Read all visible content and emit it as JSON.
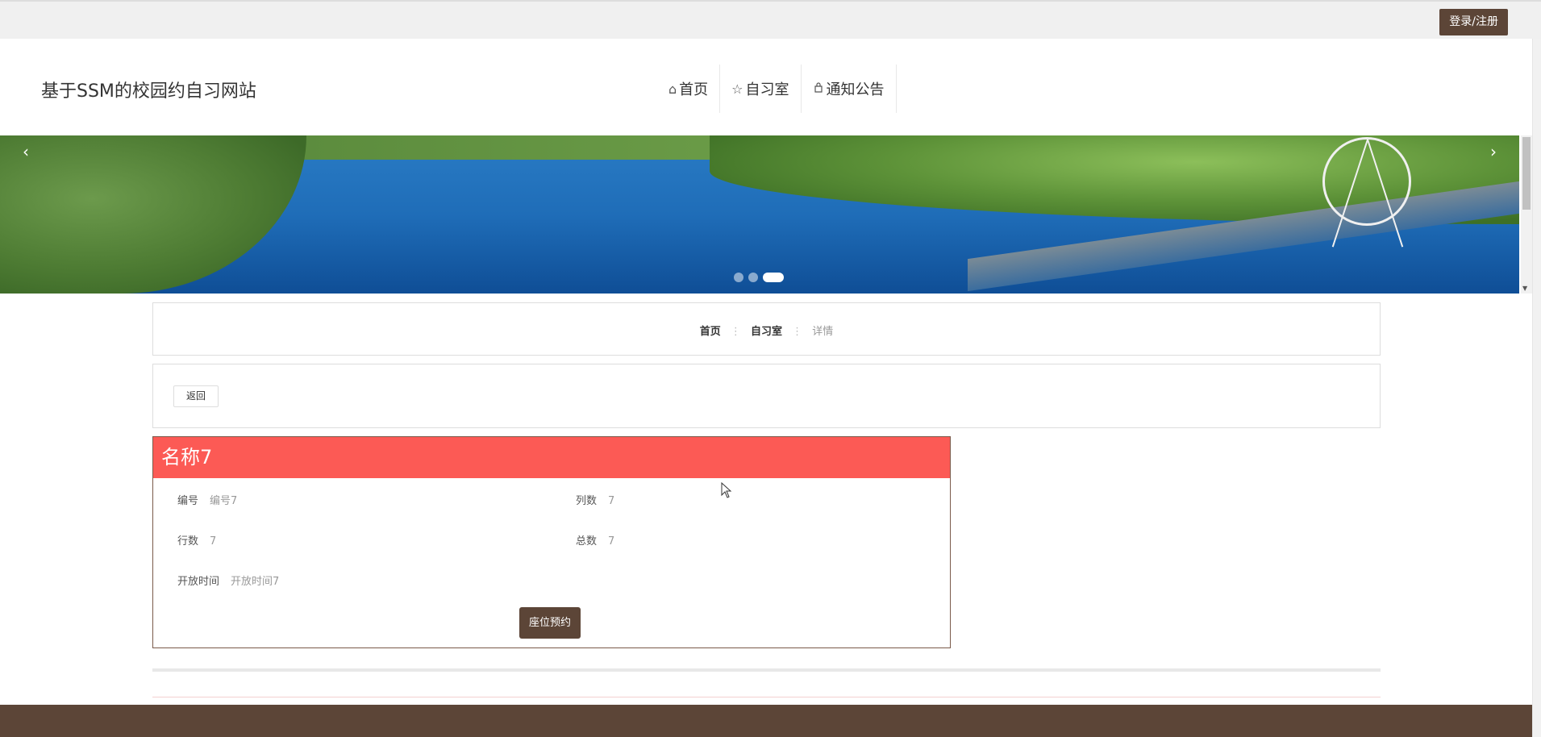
{
  "topbar": {
    "login_label": "登录/注册"
  },
  "header": {
    "site_title": "基于SSM的校园约自习网站",
    "nav": [
      {
        "icon": "home-icon",
        "label": "首页"
      },
      {
        "icon": "star-icon",
        "label": "自习室"
      },
      {
        "icon": "bag-icon",
        "label": "通知公告"
      }
    ]
  },
  "banner": {
    "active_slide": 3,
    "slide_count": 3,
    "prev_arrow": "‹",
    "next_arrow": "›"
  },
  "breadcrumb": {
    "home": "首页",
    "section": "自习室",
    "current": "详情",
    "separator": "⋮"
  },
  "actions": {
    "back_label": "返回"
  },
  "detail": {
    "title": "名称7",
    "fields": {
      "code_label": "编号",
      "code_value": "编号7",
      "cols_label": "列数",
      "cols_value": "7",
      "rows_label": "行数",
      "rows_value": "7",
      "total_label": "总数",
      "total_value": "7",
      "open_label": "开放时间",
      "open_value": "开放时间7"
    },
    "reserve_label": "座位预约"
  },
  "colors": {
    "brand": "#5c4537",
    "header_red": "#fc5a55"
  }
}
